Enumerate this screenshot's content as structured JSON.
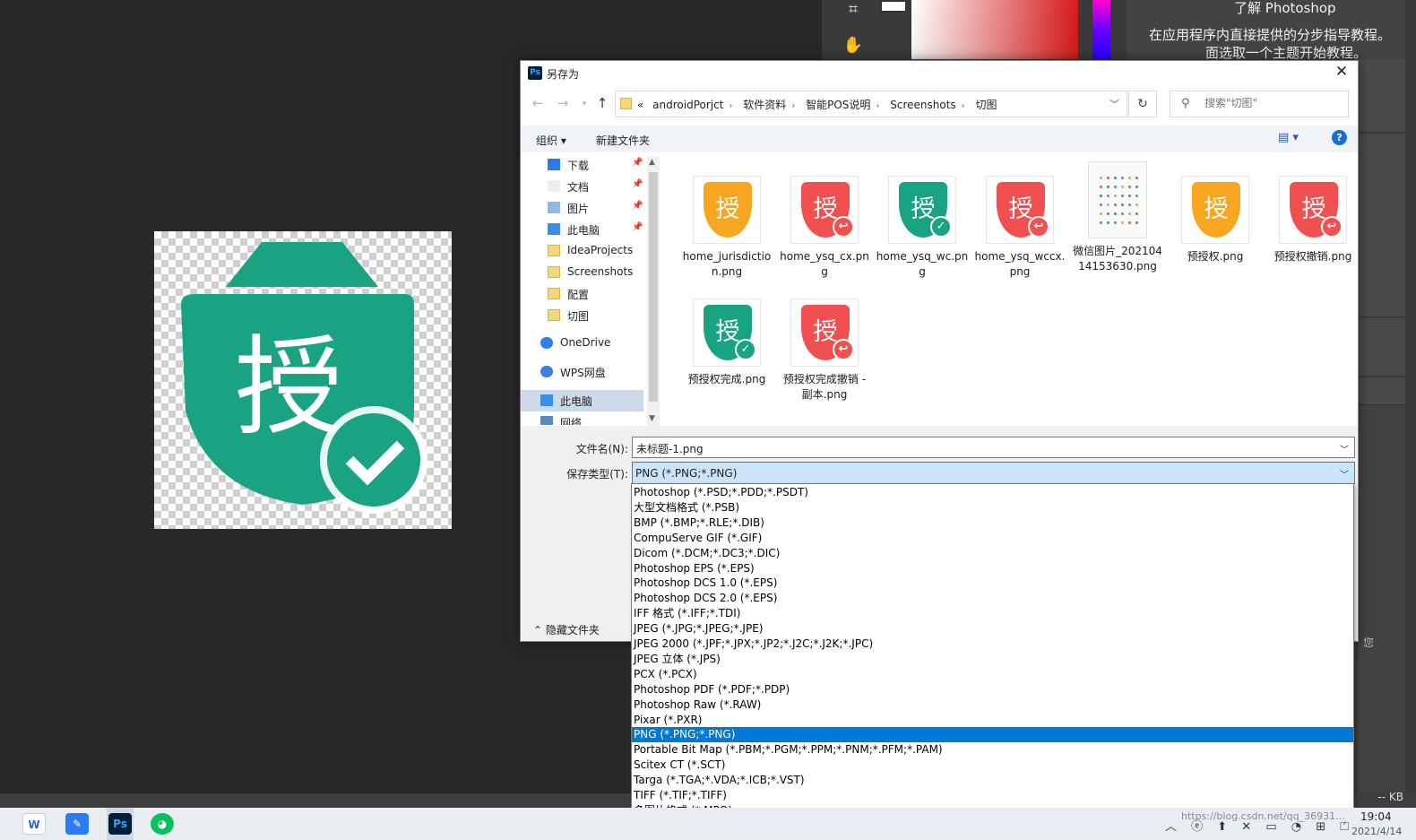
{
  "photoshop": {
    "learn_title": "了解 Photoshop",
    "learn_line1": "在应用程序内直接提供的分步指导教程。",
    "learn_line2": "面选取一个主题开始教程。",
    "status_text": "-- KB",
    "side_text": "您"
  },
  "dialog": {
    "title": "另存为",
    "breadcrumb_prefix": "«",
    "breadcrumb": [
      "androidPorjct",
      "软件资料",
      "智能POS说明",
      "Screenshots",
      "切图"
    ],
    "search_placeholder": "搜索\"切图\"",
    "toolbar": {
      "organize": "组织",
      "new_folder": "新建文件夹"
    },
    "nav_items": [
      {
        "label": "下载",
        "icon": "download-icon",
        "pinned": true
      },
      {
        "label": "文档",
        "icon": "document-icon",
        "pinned": true
      },
      {
        "label": "图片",
        "icon": "pictures-icon",
        "pinned": true
      },
      {
        "label": "此电脑",
        "icon": "computer-icon",
        "pinned": true
      },
      {
        "label": "IdeaProjects",
        "icon": "folder-icon",
        "pinned": false
      },
      {
        "label": "Screenshots",
        "icon": "folder-icon",
        "pinned": false
      },
      {
        "label": "配置",
        "icon": "folder-icon",
        "pinned": false
      },
      {
        "label": "切图",
        "icon": "folder-icon",
        "pinned": false
      },
      {
        "label": "OneDrive",
        "icon": "onedrive-icon",
        "pinned": false
      },
      {
        "label": "WPS网盘",
        "icon": "cloud-icon",
        "pinned": false
      },
      {
        "label": "此电脑",
        "icon": "computer-icon",
        "pinned": false,
        "selected": true
      },
      {
        "label": "网络",
        "icon": "network-icon",
        "pinned": false
      }
    ],
    "files": [
      {
        "name": "home_jurisdiction.png",
        "char": "授",
        "color": "orange",
        "badge": ""
      },
      {
        "name": "home_ysq_cx.png",
        "char": "授",
        "color": "red",
        "badge": "back"
      },
      {
        "name": "home_ysq_wc.png",
        "char": "授",
        "color": "green",
        "badge": "check"
      },
      {
        "name": "home_ysq_wccx.png",
        "char": "授",
        "color": "red",
        "badge": "back"
      },
      {
        "name": "微信图片_20210414153630.png",
        "char": "",
        "color": "doc",
        "badge": ""
      },
      {
        "name": "预授权.png",
        "char": "授",
        "color": "orange",
        "badge": ""
      },
      {
        "name": "预授权撤销.png",
        "char": "授",
        "color": "red",
        "badge": "back"
      },
      {
        "name": "预授权完成.png",
        "char": "授",
        "color": "green",
        "badge": "check"
      },
      {
        "name": "预授权完成撤销 - 副本.png",
        "char": "授",
        "color": "red",
        "badge": "back"
      }
    ],
    "file_name_label": "文件名(N):",
    "file_name_value": "未标题-1.png",
    "save_type_label": "保存类型(T):",
    "save_type_value": "PNG (*.PNG;*.PNG)",
    "hide_folders": "隐藏文件夹",
    "type_options": [
      "Photoshop (*.PSD;*.PDD;*.PSDT)",
      "大型文档格式 (*.PSB)",
      "BMP (*.BMP;*.RLE;*.DIB)",
      "CompuServe GIF (*.GIF)",
      "Dicom (*.DCM;*.DC3;*.DIC)",
      "Photoshop EPS (*.EPS)",
      "Photoshop DCS 1.0 (*.EPS)",
      "Photoshop DCS 2.0 (*.EPS)",
      "IFF 格式 (*.IFF;*.TDI)",
      "JPEG (*.JPG;*.JPEG;*.JPE)",
      "JPEG 2000 (*.JPF;*.JPX;*.JP2;*.J2C;*.J2K;*.JPC)",
      "JPEG 立体 (*.JPS)",
      "PCX (*.PCX)",
      "Photoshop PDF (*.PDF;*.PDP)",
      "Photoshop Raw (*.RAW)",
      "Pixar (*.PXR)",
      "PNG (*.PNG;*.PNG)",
      "Portable Bit Map (*.PBM;*.PGM;*.PPM;*.PNM;*.PFM;*.PAM)",
      "Scitex CT (*.SCT)",
      "Targa (*.TGA;*.VDA;*.ICB;*.VST)",
      "TIFF (*.TIF;*.TIFF)",
      "多图片格式 (*.MPO)"
    ],
    "selected_option": "PNG (*.PNG;*.PNG)"
  },
  "canvas": {
    "char": "授"
  },
  "taskbar": {
    "clock_time": "19:04",
    "clock_date": "2021/4/14",
    "watermark": "https://blog.csdn.net/qq_36931..."
  },
  "colors": {
    "green": "#1aa383",
    "orange": "#f6a621",
    "red": "#f05150",
    "selection": "#0078d7"
  }
}
